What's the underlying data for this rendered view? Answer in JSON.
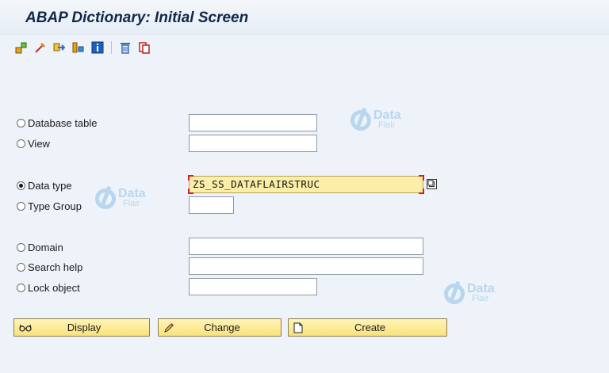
{
  "window": {
    "title": "ABAP Dictionary: Initial Screen"
  },
  "toolbar": {
    "icons": [
      "other-object-icon",
      "where-used-icon",
      "check-icon",
      "activate-icon",
      "info-icon",
      "delete-icon",
      "copy-icon"
    ]
  },
  "options": [
    {
      "label": "Database table",
      "selected": false,
      "value": ""
    },
    {
      "label": "View",
      "selected": false,
      "value": ""
    },
    {
      "label": "Data type",
      "selected": true,
      "value": "ZS_SS_DATAFLAIRSTRUC"
    },
    {
      "label": "Type Group",
      "selected": false,
      "value": ""
    },
    {
      "label": "Domain",
      "selected": false,
      "value": ""
    },
    {
      "label": "Search help",
      "selected": false,
      "value": ""
    },
    {
      "label": "Lock object",
      "selected": false,
      "value": ""
    }
  ],
  "buttons": {
    "display": "Display",
    "change": "Change",
    "create": "Create"
  },
  "watermark": {
    "line1": "Data",
    "line2": "Flair"
  },
  "colors": {
    "title": "#10284a",
    "field_active": "#fbeea8",
    "button": "#f9e27a",
    "required_marker": "#d02020"
  }
}
